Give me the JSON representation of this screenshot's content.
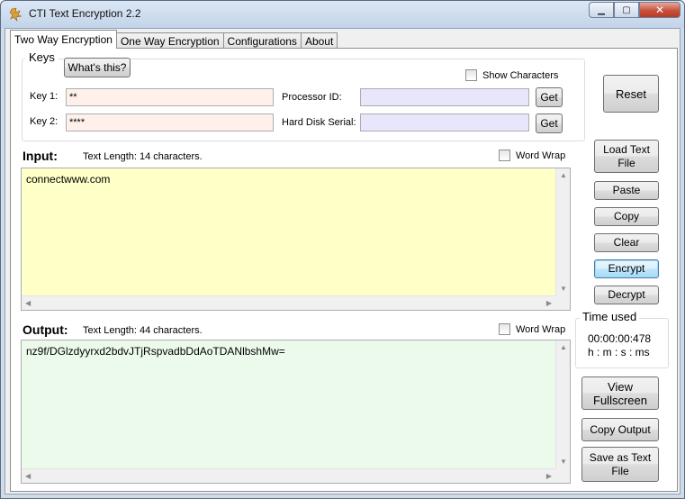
{
  "window": {
    "title": "CTI Text Encryption 2.2",
    "controls": {
      "minimize": "▁",
      "maximize": "▢",
      "close": "✕"
    }
  },
  "tabs": [
    {
      "label": "Two Way Encryption",
      "active": true
    },
    {
      "label": "One Way Encryption",
      "active": false
    },
    {
      "label": "Configurations",
      "active": false
    },
    {
      "label": "About",
      "active": false
    }
  ],
  "keys": {
    "title": "Keys",
    "whats_this": "What's this?",
    "show_characters": "Show Characters",
    "key1_label": "Key 1:",
    "key1_value": "**",
    "key2_label": "Key 2:",
    "key2_value": "****",
    "processor_label": "Processor ID:",
    "processor_value": "",
    "disk_label": "Hard Disk Serial:",
    "disk_value": "",
    "get_label": "Get"
  },
  "input": {
    "title": "Input:",
    "length_text": "Text Length: 14 characters.",
    "word_wrap": "Word Wrap",
    "text": "connectwww.com"
  },
  "output": {
    "title": "Output:",
    "length_text": "Text Length: 44 characters.",
    "word_wrap": "Word Wrap",
    "text": "nz9f/DGlzdyyrxd2bdvJTjRspvadbDdAoTDANlbshMw="
  },
  "buttons": {
    "reset": "Reset",
    "load_text_file": "Load Text File",
    "paste": "Paste",
    "copy": "Copy",
    "clear": "Clear",
    "encrypt": "Encrypt",
    "decrypt": "Decrypt",
    "view_fullscreen": "View Fullscreen",
    "copy_output": "Copy Output",
    "save_as_text_file": "Save as Text File"
  },
  "time": {
    "title": "Time used",
    "value": "00:00:00:478",
    "format": "h : m : s : ms"
  },
  "colors": {
    "input_bg": "#ffffc8",
    "output_bg": "#ecfaec",
    "key_field_bg": "#fff1ea",
    "hardware_field_bg": "#e7e6fb"
  }
}
